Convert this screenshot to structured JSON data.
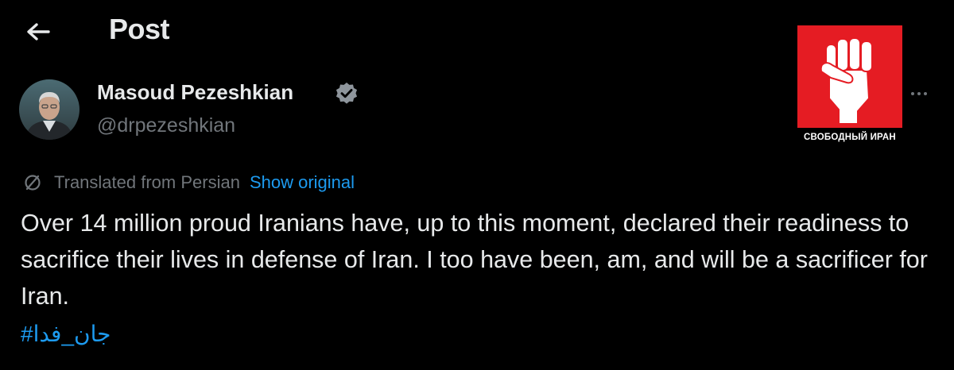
{
  "header": {
    "title": "Post",
    "back_icon": "arrow-left-icon"
  },
  "author": {
    "name": "Masoud Pezeshkian",
    "handle": "@drpezeshkian",
    "verified": true,
    "verified_color": "#8e959c"
  },
  "watermark": {
    "caption": "СВОБОДНЫЙ ИРАН",
    "background": "#e51c23",
    "icon": "raised-fist-icon"
  },
  "menu": {
    "icon": "more-horizontal-icon"
  },
  "translation": {
    "label": "Translated from Persian",
    "action": "Show original",
    "icon": "translate-globe-icon"
  },
  "tweet": {
    "text": "Over 14 million proud Iranians have, up to this moment, declared their readiness to sacrifice their lives in defense of Iran. I too have been, am, and will be a sacrificer for Iran.",
    "hashtag": "#جان_فدا"
  },
  "colors": {
    "background": "#000000",
    "text_primary": "#e7e9ea",
    "text_secondary": "#71767b",
    "link": "#1d9bf0"
  }
}
